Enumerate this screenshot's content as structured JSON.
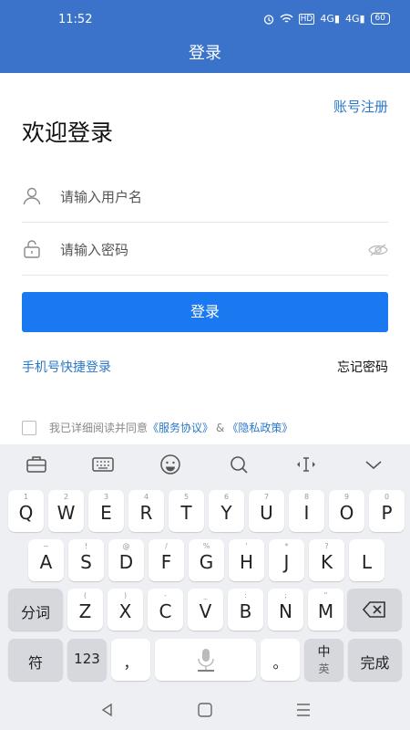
{
  "status_bar": {
    "time": "11:52",
    "hd": "HD",
    "signal1": "4G",
    "signal2": "4G",
    "battery": "60"
  },
  "header": {
    "title": "登录"
  },
  "register_link": "账号注册",
  "welcome_title": "欢迎登录",
  "username_field": {
    "placeholder": "请输入用户名",
    "value": ""
  },
  "password_field": {
    "placeholder": "请输入密码",
    "value": ""
  },
  "login_button": "登录",
  "phone_login_link": "手机号快捷登录",
  "forgot_password_link": "忘记密码",
  "agreement": {
    "prefix": "我已详细阅读并同意",
    "service_link": "《服务协议》",
    "amp": "&",
    "privacy_link": "《隐私政策》"
  },
  "keyboard": {
    "toolbar_icons": [
      "briefcase-icon",
      "keyboard-icon",
      "emoji-icon",
      "search-icon",
      "cursor-icon",
      "collapse-icon"
    ],
    "row1": [
      {
        "main": "Q",
        "sub": "1"
      },
      {
        "main": "W",
        "sub": "2"
      },
      {
        "main": "E",
        "sub": "3"
      },
      {
        "main": "R",
        "sub": "4"
      },
      {
        "main": "T",
        "sub": "5"
      },
      {
        "main": "Y",
        "sub": "6"
      },
      {
        "main": "U",
        "sub": "7"
      },
      {
        "main": "I",
        "sub": "8"
      },
      {
        "main": "O",
        "sub": "9"
      },
      {
        "main": "P",
        "sub": "0"
      }
    ],
    "row2": [
      {
        "main": "A",
        "sub": "~"
      },
      {
        "main": "S",
        "sub": "!"
      },
      {
        "main": "D",
        "sub": "@"
      },
      {
        "main": "F",
        "sub": "/"
      },
      {
        "main": "G",
        "sub": "%"
      },
      {
        "main": "H",
        "sub": "'"
      },
      {
        "main": "J",
        "sub": "*"
      },
      {
        "main": "K",
        "sub": "?"
      },
      {
        "main": "L",
        "sub": ""
      }
    ],
    "row3": [
      {
        "main": "Z",
        "sub": "("
      },
      {
        "main": "X",
        "sub": ")"
      },
      {
        "main": "C",
        "sub": "-"
      },
      {
        "main": "V",
        "sub": "_"
      },
      {
        "main": "B",
        "sub": ":"
      },
      {
        "main": "N",
        "sub": ";"
      },
      {
        "main": "M",
        "sub": "\""
      }
    ],
    "fenci": "分词",
    "fu": "符",
    "num": "123",
    "comma": "，",
    "period": "。",
    "lang_top": "中",
    "lang_bottom": "英",
    "done": "完成"
  }
}
